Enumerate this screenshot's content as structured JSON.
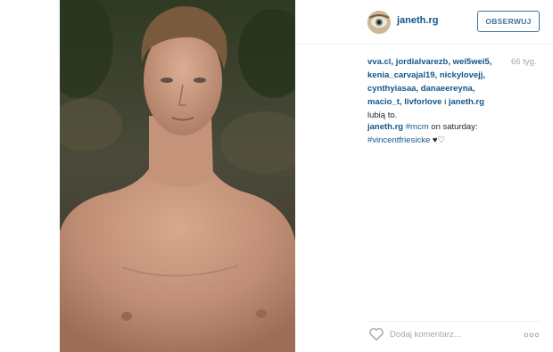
{
  "post": {
    "image_alt": "shirtless young man with short tousled hair in a forest",
    "colors": {
      "link": "#125688",
      "follow_border": "#3f729b",
      "muted": "#a5a7aa"
    }
  },
  "header": {
    "username": "janeth.rg",
    "follow_label": "OBSERWUJ",
    "avatar_icon": "avatar-icon"
  },
  "likes": {
    "users": [
      "vva.cl",
      "jordialvarezb",
      "wei5wei5",
      "kenia_carvajal19",
      "nickylovejj",
      "cynthyiasaa",
      "danaeereyna",
      "macio_t",
      "livforlove",
      "janeth.rg"
    ],
    "and_word": "i",
    "suffix": "lubią to."
  },
  "time": "66 tyg.",
  "caption": {
    "username": "janeth.rg",
    "hashtag": "#mcm",
    "text": "on saturday:",
    "mention": "#vincentfriesicke",
    "emoji": "♥♡"
  },
  "footer": {
    "comment_placeholder": "Dodaj komentarz...",
    "heart_icon": "heart-icon",
    "more_icon": "more-options-icon"
  }
}
